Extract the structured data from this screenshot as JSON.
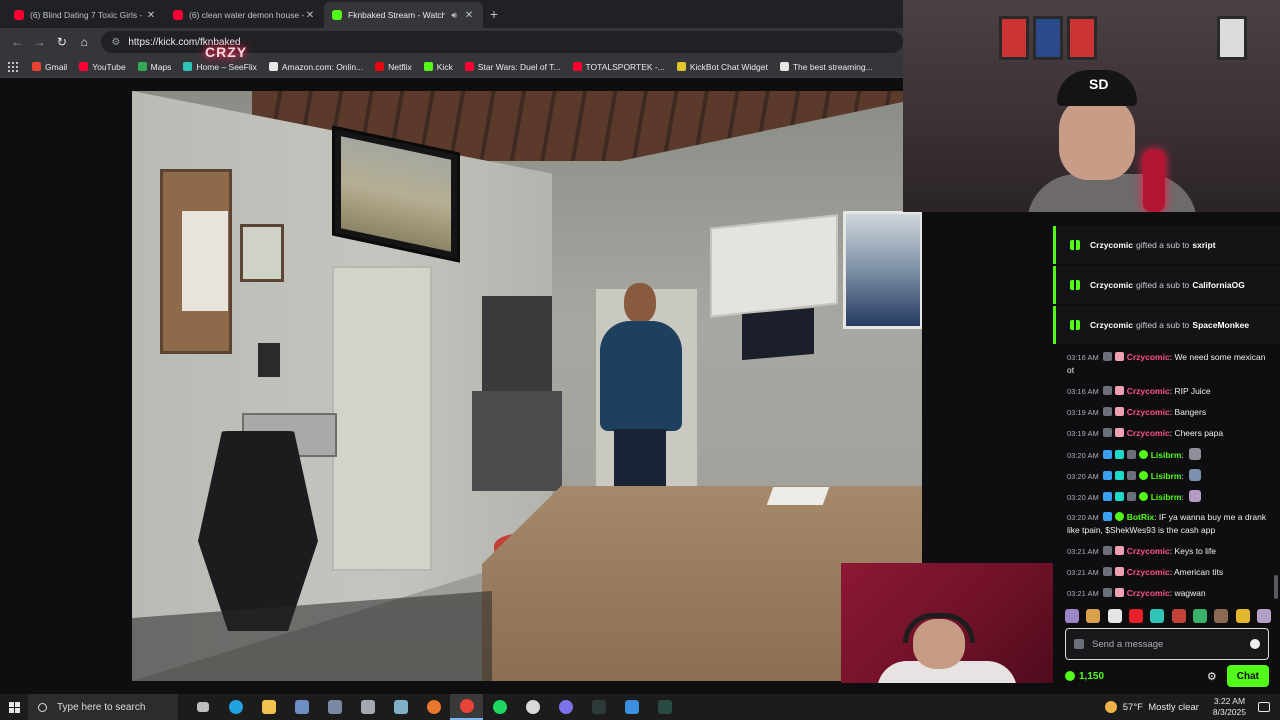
{
  "browser": {
    "tabs": [
      {
        "title": "(6) Blind Dating 7 Toxic Girls - Y",
        "kind": "yt",
        "active": false
      },
      {
        "title": "(6) clean water demon house -",
        "kind": "yt",
        "active": false
      },
      {
        "title": "Fknbaked Stream - Watch L",
        "kind": "kick",
        "active": true
      }
    ],
    "url": "https://kick.com/fknbaked",
    "bookmarks": [
      "Gmail",
      "YouTube",
      "Maps",
      "Home – SeeFlix",
      "Amazon.com: Onlin...",
      "Netflix",
      "Kick",
      "Star Wars: Duel of T...",
      "TOTALSPORTEK -...",
      "KickBot Chat Widget",
      "The best streaming..."
    ]
  },
  "stream": {
    "neon_sign": "CRZY"
  },
  "chat": {
    "gifts": [
      {
        "gifter": "Crzycomic",
        "text": "gifted a sub to",
        "recipient": "sxript"
      },
      {
        "gifter": "Crzycomic",
        "text": "gifted a sub to",
        "recipient": "CaliforniaOG"
      },
      {
        "gifter": "Crzycomic",
        "text": "gifted a sub to",
        "recipient": "SpaceMonkee"
      }
    ],
    "messages": [
      {
        "time": "03:16 AM",
        "user": "Crzycomic",
        "text": "We need some mexican ot"
      },
      {
        "time": "03:16 AM",
        "user": "Crzycomic",
        "text": "RIP Juice"
      },
      {
        "time": "03:19 AM",
        "user": "Crzycomic",
        "text": "Bangers"
      },
      {
        "time": "03:19 AM",
        "user": "Crzycomic",
        "text": "Cheers papa"
      },
      {
        "time": "03:20 AM",
        "user": "Lisibrm",
        "text": ""
      },
      {
        "time": "03:20 AM",
        "user": "Lisibrm",
        "text": ""
      },
      {
        "time": "03:20 AM",
        "user": "Lisibrm",
        "text": ""
      },
      {
        "time": "03:20 AM",
        "user": "BotRix",
        "text": "IF ya wanna buy me a drank like tpain, $ShekWes93 is the cash app"
      },
      {
        "time": "03:21 AM",
        "user": "Crzycomic",
        "text": "Keys to life"
      },
      {
        "time": "03:21 AM",
        "user": "Crzycomic",
        "text": "American tits"
      },
      {
        "time": "03:21 AM",
        "user": "Crzycomic",
        "text": "wagwan"
      }
    ],
    "input_placeholder": "Send a message",
    "points": "1,150",
    "chat_button": "Chat",
    "accent": "#53fc18"
  },
  "taskbar": {
    "search_placeholder": "Type here to search",
    "weather_temp": "57°F",
    "weather_desc": "Mostly clear",
    "time": "3:22 AM",
    "date": "8/3/2025"
  }
}
